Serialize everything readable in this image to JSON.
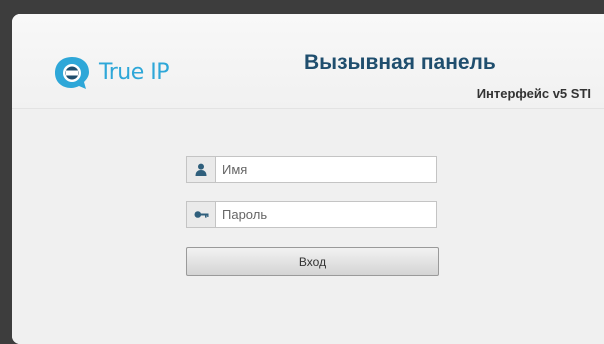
{
  "header": {
    "logo_text": "True IP",
    "title": "Вызывная панель",
    "subtitle": "Интерфейс v5 STI"
  },
  "form": {
    "username": {
      "placeholder": "Имя",
      "value": "",
      "icon": "user-icon"
    },
    "password": {
      "placeholder": "Пароль",
      "value": "",
      "icon": "key-icon"
    },
    "submit_label": "Вход"
  },
  "colors": {
    "brand": "#2ea7d8",
    "title": "#1f4e6e",
    "icon": "#2f5f7c",
    "frame": "#3d3d3d"
  }
}
